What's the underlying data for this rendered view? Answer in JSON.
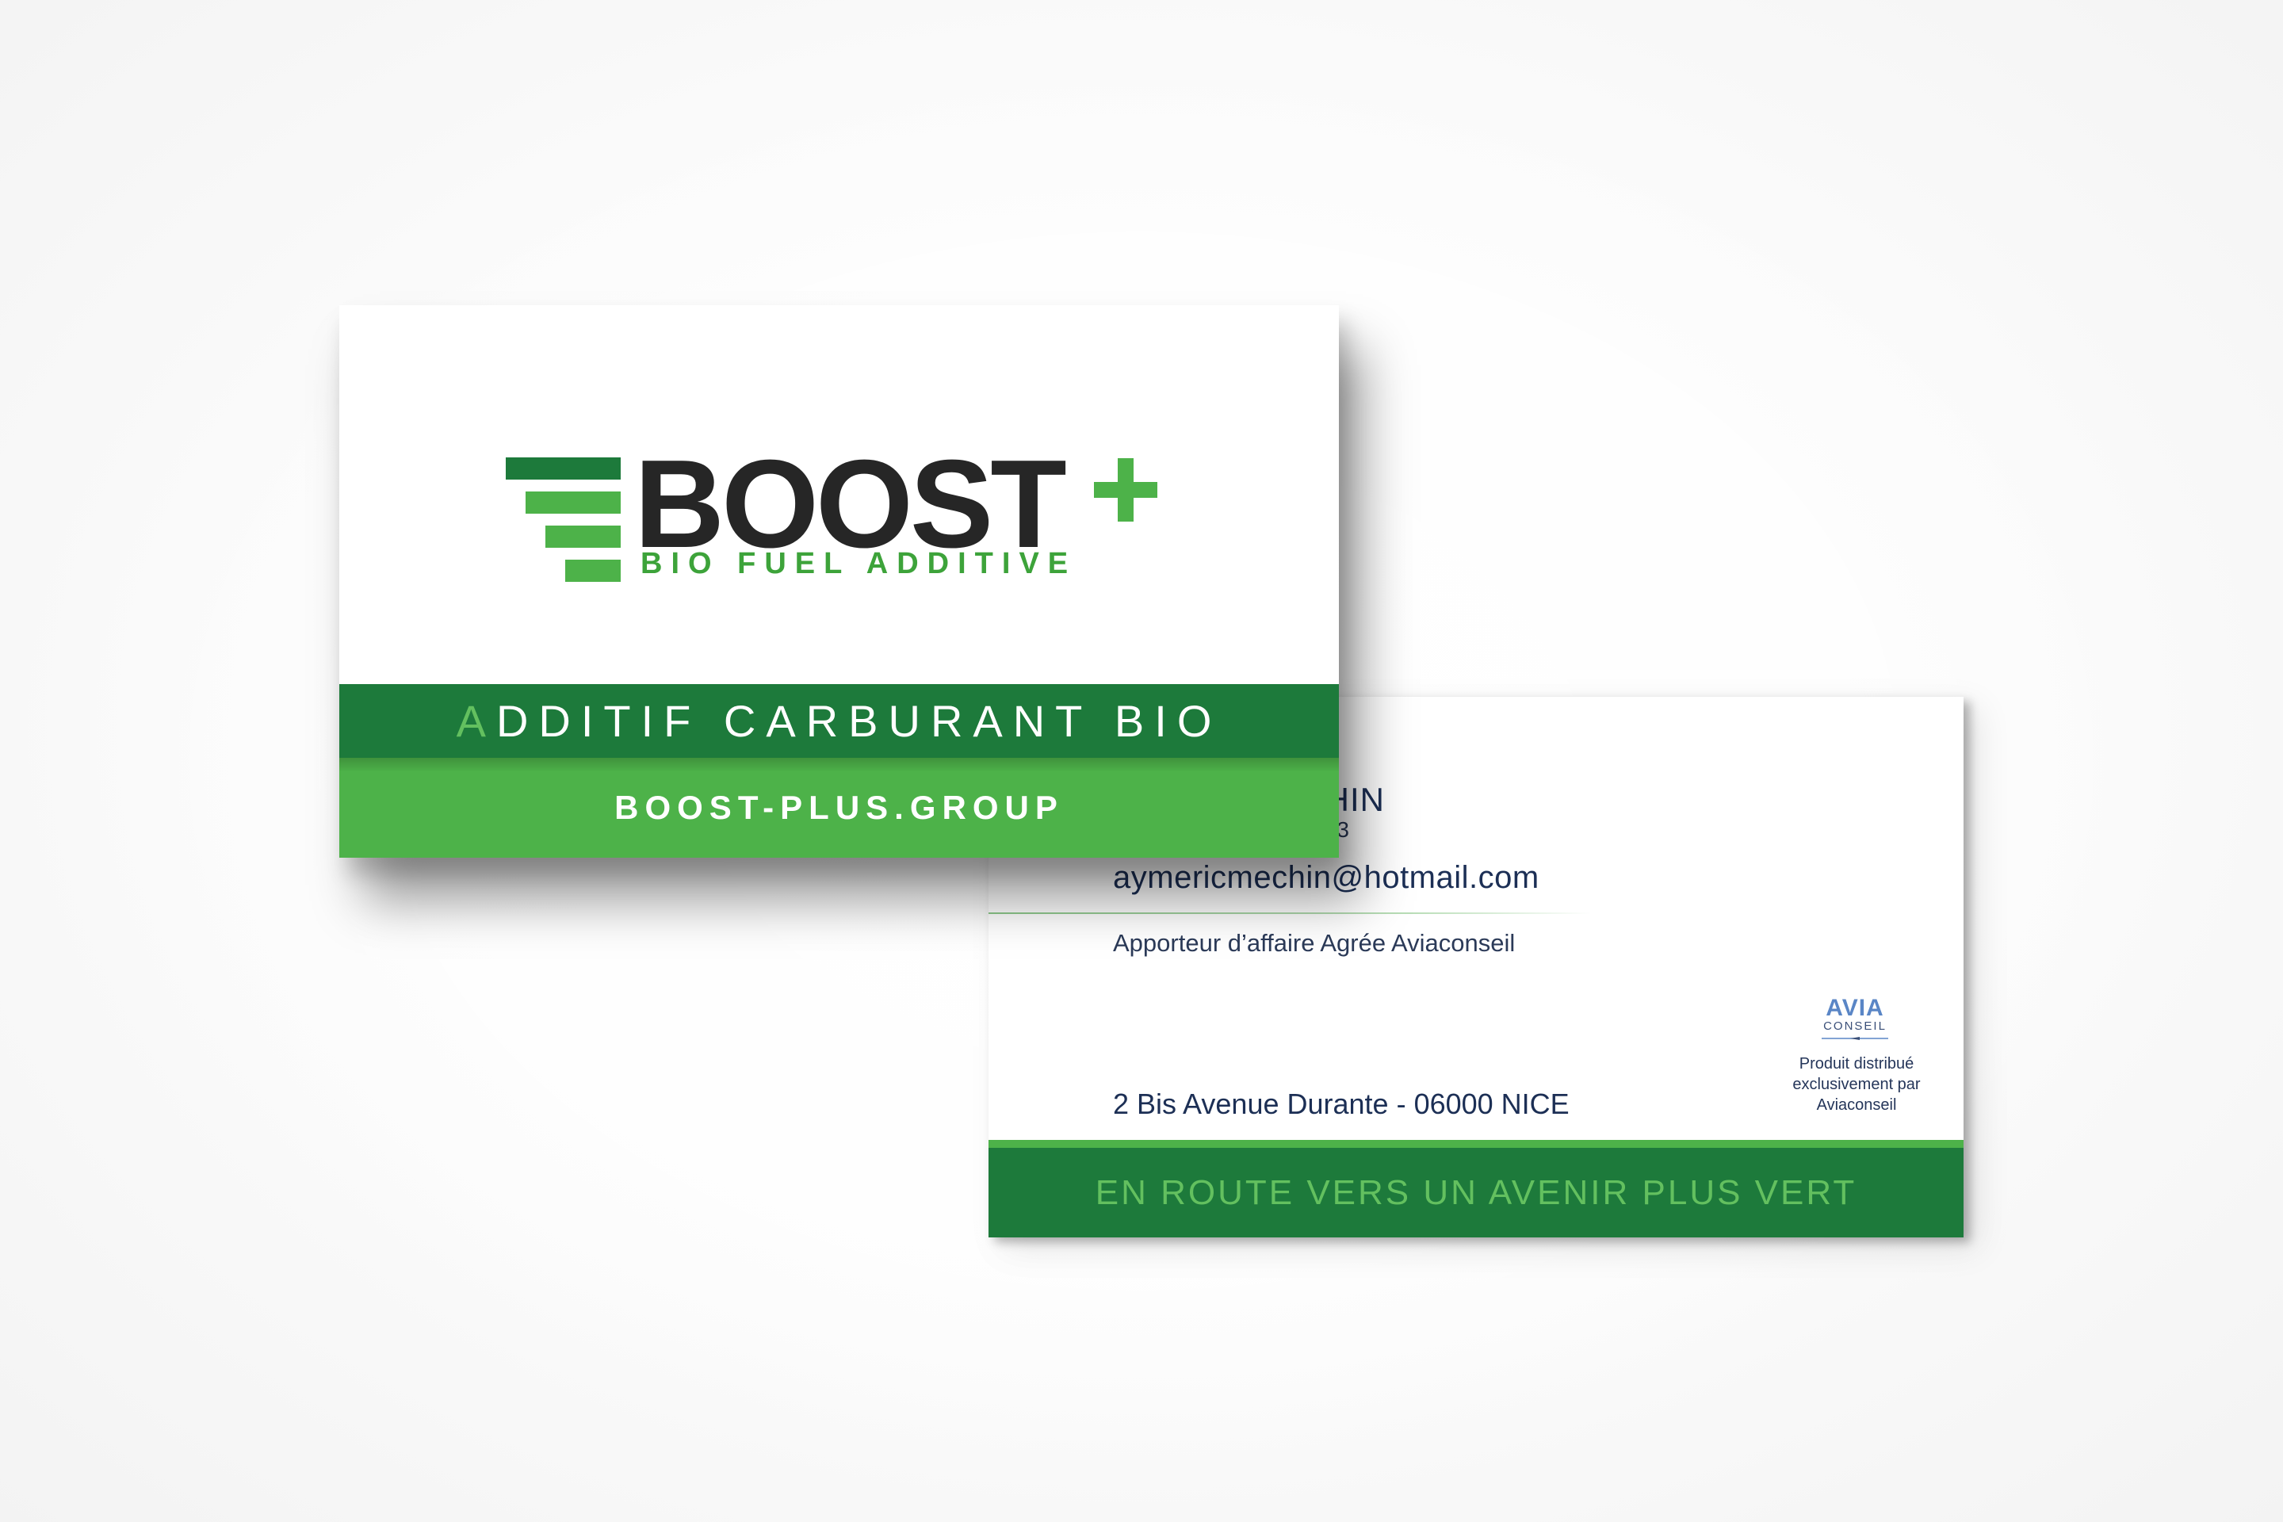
{
  "back_card": {
    "name_partial": "HIN",
    "code_partial": "3",
    "email": "aymericmechin@hotmail.com",
    "role": "Apporteur d’affaire Agrée Aviaconseil",
    "address": "2 Bis Avenue Durante - 06000 NICE",
    "partner_logo": {
      "word": "AVIA",
      "sub": "CONSEIL"
    },
    "distribution_note": "Produit distribué exclusivement par Aviaconseil",
    "slogan": "EN ROUTE VERS UN AVENIR PLUS VERT"
  },
  "front_card": {
    "logo_word": "BOOST",
    "logo_tag": "BIO FUEL ADDITIVE",
    "tagline_initial": "A",
    "tagline_rest": "DDITIF CARBURANT BIO",
    "url": "BOOST-PLUS.GROUP"
  },
  "colors": {
    "dark_green": "#1d7a3b",
    "light_green": "#4db249",
    "navy_text": "#1c2f55",
    "logo_black": "#262626",
    "avia_blue": "#5a86c6"
  },
  "icons": [
    "speed-bars-icon",
    "plus-icon",
    "avia-wing-icon"
  ]
}
